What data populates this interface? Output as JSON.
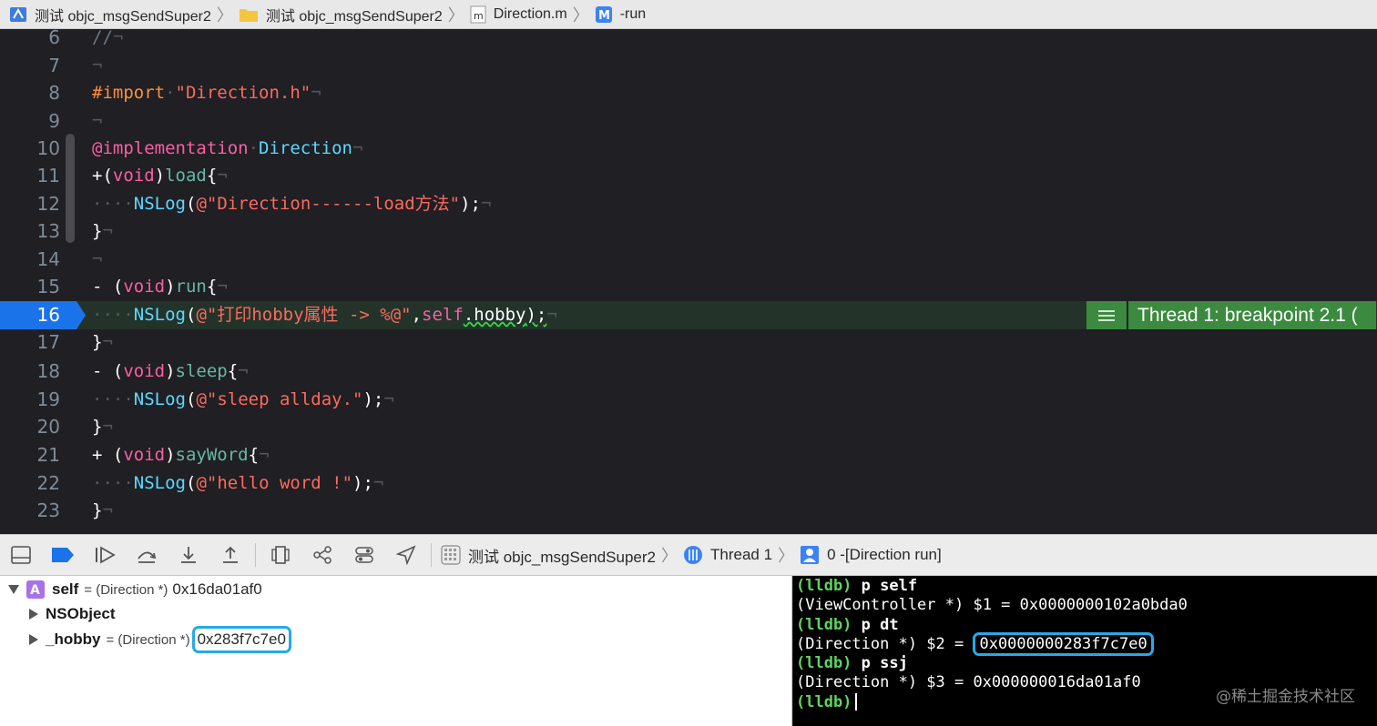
{
  "jumpbar": {
    "project": "测试 objc_msgSendSuper2",
    "folder": "测试 objc_msgSendSuper2",
    "file": "Direction.m",
    "method": "-run"
  },
  "editor": {
    "lines": [
      {
        "n": "6"
      },
      {
        "n": "7"
      },
      {
        "n": "8"
      },
      {
        "n": "9"
      },
      {
        "n": "10"
      },
      {
        "n": "11"
      },
      {
        "n": "12"
      },
      {
        "n": "13"
      },
      {
        "n": "14"
      },
      {
        "n": "15"
      },
      {
        "n": "16"
      },
      {
        "n": "17"
      },
      {
        "n": "18"
      },
      {
        "n": "19"
      },
      {
        "n": "20"
      },
      {
        "n": "21"
      },
      {
        "n": "22"
      },
      {
        "n": "23"
      }
    ],
    "code": {
      "l6": "//",
      "l8_pre": "#import",
      "l8_str": "\"Direction.h\"",
      "l10_kw": "@implementation",
      "l10_cls": "Direction",
      "l11_sign": "+(",
      "l11_type": "void",
      "l11_close": ")",
      "l11_meth": "load",
      "l11_brace": "{",
      "l12_fn": "NSLog",
      "l12_open": "(",
      "l12_str": "@\"Direction------load方法\"",
      "l12_end": ");",
      "brace_close": "}",
      "l15_sign": "- (",
      "l15_type": "void",
      "l15_close": ")",
      "l15_meth": "run",
      "l15_brace": "{",
      "l16_fn": "NSLog",
      "l16_open": "(",
      "l16_str": "@\"打印hobby属性 -> %@\"",
      "l16_comma": ",",
      "l16_self": "self",
      "l16_prop": ".hobby",
      "l16_end": ");",
      "l18_sign": "- (",
      "l18_type": "void",
      "l18_close": ")",
      "l18_meth": "sleep",
      "l18_brace": "{",
      "l19_fn": "NSLog",
      "l19_open": "(",
      "l19_str": "@\"sleep allday.\"",
      "l19_end": ");",
      "l21_sign": "+ (",
      "l21_type": "void",
      "l21_close": ")",
      "l21_meth": "sayWord",
      "l21_brace": "{",
      "l22_fn": "NSLog",
      "l22_open": "(",
      "l22_str": "@\"hello word !\"",
      "l22_end": ");"
    },
    "breakpoint_label": "Thread 1: breakpoint 2.1 ("
  },
  "debugbar": {
    "process": "测试 objc_msgSendSuper2",
    "thread": "Thread 1",
    "frame": "0 -[Direction run]"
  },
  "variables": {
    "self_name": "self",
    "self_type": "= (Direction *)",
    "self_value": "0x16da01af0",
    "nsobject": "NSObject",
    "hobby_name": "_hobby",
    "hobby_type": "= (Direction *)",
    "hobby_value": "0x283f7c7e0"
  },
  "console": {
    "prompt": "(lldb)",
    "lines": [
      {
        "cmd": "p self"
      },
      {
        "out": "(ViewController *) $1 = 0x0000000102a0bda0"
      },
      {
        "cmd": "p dt"
      },
      {
        "out_prefix": "(Direction *) $2 = ",
        "out_value": "0x0000000283f7c7e0"
      },
      {
        "cmd": "p ssj"
      },
      {
        "out": "(Direction *) $3 = 0x000000016da01af0"
      }
    ],
    "watermark": "@稀土掘金技术社区"
  },
  "colors": {
    "editor_bg": "#1f1f24",
    "breakpoint_blue": "#1a73e8",
    "breakpoint_green": "#3c8a3f",
    "highlight_box": "#28a8e8",
    "lldb_prompt": "#5fd35f"
  }
}
